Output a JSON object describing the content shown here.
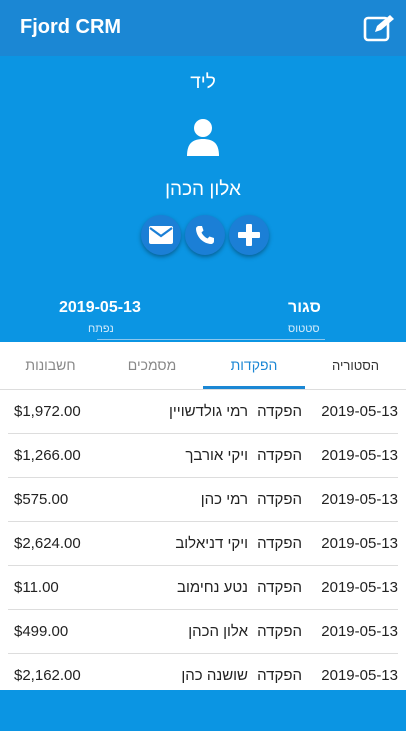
{
  "app": {
    "title": "Fjord CRM"
  },
  "hero": {
    "label": "ליד",
    "name": "אלון הכהן",
    "status_value": "סגור",
    "status_label": "סטטוס",
    "opened_value": "2019-05-13",
    "opened_label": "נפתח"
  },
  "tabs": [
    {
      "label": "הסטוריה",
      "active": false
    },
    {
      "label": "הפקדות",
      "active": true
    },
    {
      "label": "מסמכים",
      "active": false
    },
    {
      "label": "חשבונות",
      "active": false
    }
  ],
  "rows": [
    {
      "date": "2019-05-13",
      "type": "הפקדה",
      "person": "רמי גולדשויין",
      "amount": "$1,972.00"
    },
    {
      "date": "2019-05-13",
      "type": "הפקדה",
      "person": "ויקי אורבך",
      "amount": "$1,266.00"
    },
    {
      "date": "2019-05-13",
      "type": "הפקדה",
      "person": "רמי כהן",
      "amount": "$575.00"
    },
    {
      "date": "2019-05-13",
      "type": "הפקדה",
      "person": "ויקי דניאלוב",
      "amount": "$2,624.00"
    },
    {
      "date": "2019-05-13",
      "type": "הפקדה",
      "person": "נטע נחימוב",
      "amount": "$11.00"
    },
    {
      "date": "2019-05-13",
      "type": "הפקדה",
      "person": "אלון הכהן",
      "amount": "$499.00"
    },
    {
      "date": "2019-05-13",
      "type": "הפקדה",
      "person": "שושנה כהן",
      "amount": "$2,162.00"
    }
  ],
  "colors": {
    "appbar": "#1b87d4",
    "hero": "#0b95e3",
    "accent": "#1b87d4"
  },
  "icons": [
    "edit-icon",
    "person-icon",
    "mail-icon",
    "phone-icon",
    "plus-icon"
  ]
}
